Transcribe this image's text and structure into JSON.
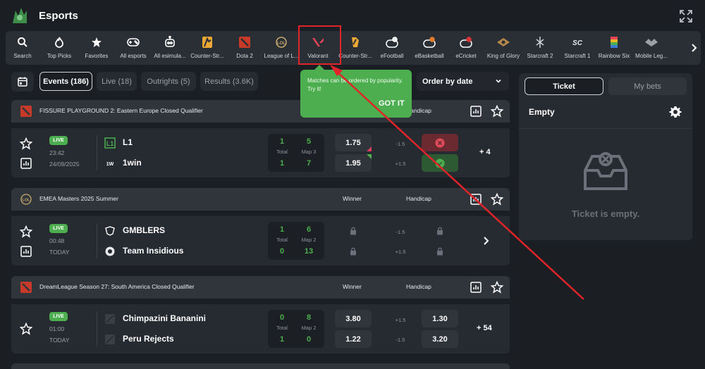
{
  "header": {
    "title": "Esports"
  },
  "sports": [
    {
      "label": "Search",
      "icon": "search-icon"
    },
    {
      "label": "Top Picks",
      "icon": "flame-icon"
    },
    {
      "label": "Favorites",
      "icon": "star-icon"
    },
    {
      "label": "All esports",
      "icon": "gamepad-icon"
    },
    {
      "label": "All esimula...",
      "icon": "robot-icon"
    },
    {
      "label": "Counter-Str...",
      "icon": "counter-strike-icon"
    },
    {
      "label": "Dota 2",
      "icon": "dota2-icon"
    },
    {
      "label": "League of L...",
      "icon": "league-of-legends-icon"
    },
    {
      "label": "Valorant",
      "icon": "valorant-icon"
    },
    {
      "label": "Counter-Str...",
      "icon": "counter-strike-2-icon"
    },
    {
      "label": "eFootball",
      "icon": "efootball-icon"
    },
    {
      "label": "eBasketball",
      "icon": "ebasketball-icon"
    },
    {
      "label": "eCricket",
      "icon": "ecricket-icon"
    },
    {
      "label": "King of Glory",
      "icon": "king-of-glory-icon"
    },
    {
      "label": "Starcraft 2",
      "icon": "starcraft2-icon"
    },
    {
      "label": "Starcraft 1",
      "icon": "starcraft1-icon"
    },
    {
      "label": "Rainbow Six",
      "icon": "rainbow-six-icon"
    },
    {
      "label": "Mobile Leg...",
      "icon": "mobile-legends-icon"
    }
  ],
  "filters": {
    "tabs": [
      "Events (186)",
      "Live (18)",
      "Outrights (5)",
      "Results (3.6K)"
    ],
    "order_label": "Order by date"
  },
  "tooltip": {
    "message": "Matches can be ordered by popularity. Try it!",
    "button": "GOT IT"
  },
  "leagues": [
    {
      "name": "FISSURE PLAYGROUND 2: Eastern Europe Closed Qualifier",
      "col_handicap": "Handicap",
      "match": {
        "status": "LIVE",
        "time": "23:42",
        "date": "24/09/2025",
        "team1": "L1",
        "team2": "1win",
        "total_label": "Total",
        "map_label": "Map 3",
        "score1_total": "1",
        "score1_map": "5",
        "score2_total": "1",
        "score2_map": "7",
        "odds1": "1.75",
        "odds2": "1.95",
        "hcap1": "-1.5",
        "hcap2": "+1.5",
        "more": "+ 4"
      }
    },
    {
      "name": "EMEA Masters 2025 Summer",
      "col_winner": "Winner",
      "col_handicap": "Handicap",
      "match": {
        "status": "LIVE",
        "time": "00:48",
        "date": "TODAY",
        "team1": "GMBLERS",
        "team2": "Team Insidious",
        "total_label": "Total",
        "map_label": "Map 2",
        "score1_total": "1",
        "score1_map": "6",
        "score2_total": "0",
        "score2_map": "13",
        "hcap1": "-1.5",
        "hcap2": "+1.5"
      }
    },
    {
      "name": "DreamLeague Season 27: South America Closed Qualifier",
      "col_winner": "Winner",
      "col_handicap": "Handicap",
      "match": {
        "status": "LIVE",
        "time": "01:00",
        "date": "TODAY",
        "team1": "Chimpazini Bananini",
        "team2": "Peru Rejects",
        "total_label": "Total",
        "map_label": "Map 2",
        "score1_total": "0",
        "score1_map": "8",
        "score2_total": "1",
        "score2_map": "0",
        "odds1": "3.80",
        "odds2": "1.22",
        "hcap1": "+1.5",
        "hcap2": "-1.5",
        "hodds1": "1.30",
        "hodds2": "3.20",
        "more": "+ 54"
      }
    }
  ],
  "ticket": {
    "tab_ticket": "Ticket",
    "tab_mybets": "My bets",
    "empty_label": "Empty",
    "empty_message": "Ticket is empty."
  },
  "colors": {
    "live_green": "#4cae4f",
    "highlight_red": "#e0242a",
    "background": "#1b1e23"
  }
}
